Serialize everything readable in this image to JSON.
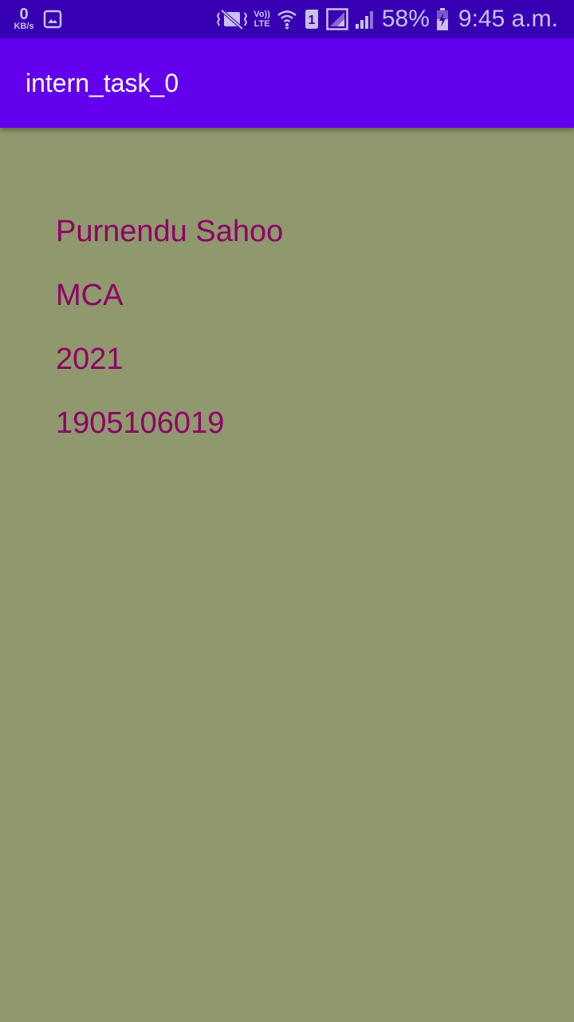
{
  "status_bar": {
    "net_speed_value": "0",
    "net_speed_unit": "KB/s",
    "volte_top": "Vo))",
    "volte_bottom": "LTE",
    "sim_slot": "1",
    "battery_percent": "58%",
    "time": "9:45 a.m.",
    "icons": [
      "gallery-icon",
      "vibrate-icon",
      "wifi-icon",
      "sim-icon",
      "signal-icon",
      "signal-icon",
      "battery-charging-icon"
    ],
    "color": "#C9C0E8",
    "background": "#3700B3"
  },
  "app_bar": {
    "title": "intern_task_0",
    "background": "#6200EE"
  },
  "profile": {
    "name": "Purnendu Sahoo",
    "course": "MCA",
    "year": "2021",
    "roll_number": "1905106019",
    "text_color": "#8E0068"
  },
  "page": {
    "background": "#8F996D"
  }
}
